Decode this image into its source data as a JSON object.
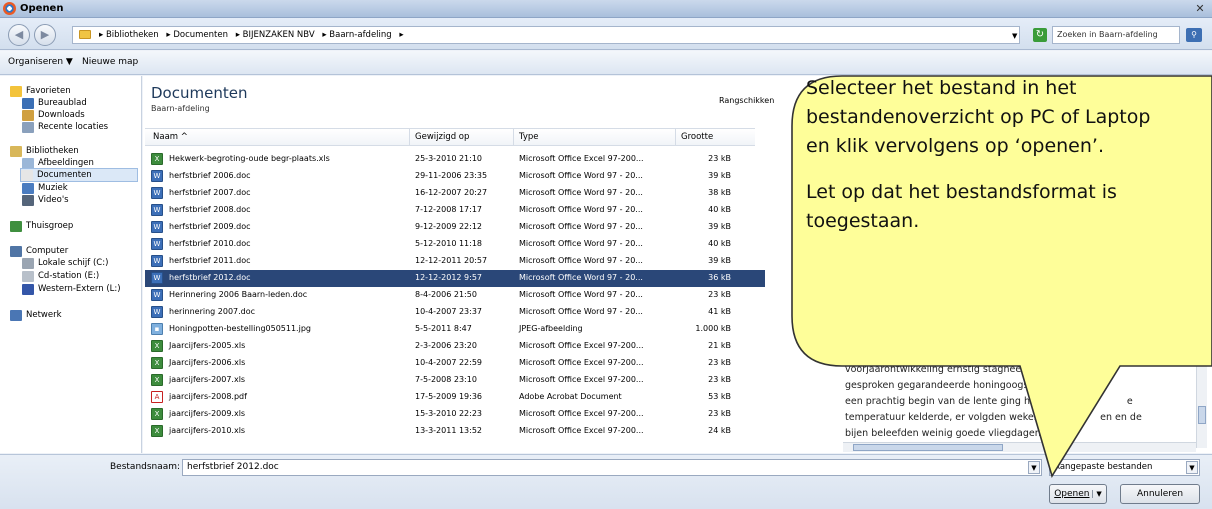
{
  "window": {
    "title": "Openen",
    "close_symbol": "✕"
  },
  "address": {
    "back": "◀",
    "forward": "▶",
    "breadcrumbs": [
      "▸ Bibliotheken",
      "▸ Documenten",
      "▸ BIJENZAKEN NBV",
      "▸ Baarn-afdeling",
      "▸"
    ],
    "dropdown": "▼",
    "search_placeholder": "Zoeken in Baarn-afdeling"
  },
  "toolbar": {
    "organize": "Organiseren ▼",
    "new_folder": "Nieuwe map"
  },
  "nav": {
    "items": [
      {
        "label": "Favorieten",
        "icon": "star-icon",
        "color": "#f3c33b"
      },
      {
        "label": "Bureaublad",
        "icon": "desktop-icon",
        "color": "#3b6fb5"
      },
      {
        "label": "Downloads",
        "icon": "downloads-icon",
        "color": "#d0a040"
      },
      {
        "label": "Recente locaties",
        "icon": "recent-icon",
        "color": "#8aa0bc"
      },
      {
        "label": "Bibliotheken",
        "icon": "library-icon",
        "color": "#d8b75a"
      },
      {
        "label": "Afbeeldingen",
        "icon": "pictures-icon",
        "color": "#9bb7d8"
      },
      {
        "label": "Documenten",
        "icon": "documents-icon",
        "color": "#e6e6e6"
      },
      {
        "label": "Muziek",
        "icon": "music-icon",
        "color": "#4a7cc0"
      },
      {
        "label": "Video's",
        "icon": "video-icon",
        "color": "#55657a"
      },
      {
        "label": "Thuisgroep",
        "icon": "homegroup-icon",
        "color": "#3f8f3f"
      },
      {
        "label": "Computer",
        "icon": "computer-icon",
        "color": "#5075a5"
      },
      {
        "label": "Lokale schijf (C:)",
        "icon": "drive-icon",
        "color": "#9aa5b2"
      },
      {
        "label": "Cd-station (E:)",
        "icon": "cd-icon",
        "color": "#b8c0ca"
      },
      {
        "label": "Western-Extern (L:)",
        "icon": "external-drive-icon",
        "color": "#3456a8"
      },
      {
        "label": "Netwerk",
        "icon": "network-icon",
        "color": "#4a76b4"
      }
    ]
  },
  "library": {
    "title": "Documenten",
    "subtitle": "Baarn-afdeling",
    "arrange_label": "Rangschikken"
  },
  "columns": {
    "name": "Naam",
    "sort_arrow": "^",
    "modified": "Gewijzigd op",
    "type": "Type",
    "size": "Grootte"
  },
  "files": [
    {
      "name": "Hekwerk-begroting-oude begr-plaats.xls",
      "date": "25-3-2010 21:10",
      "type": "Microsoft Office Excel 97-200...",
      "size": "23 kB",
      "kind": "xls"
    },
    {
      "name": "herfstbrief 2006.doc",
      "date": "29-11-2006 23:35",
      "type": "Microsoft Office Word 97 - 20...",
      "size": "39 kB",
      "kind": "doc"
    },
    {
      "name": "herfstbrief 2007.doc",
      "date": "16-12-2007 20:27",
      "type": "Microsoft Office Word 97 - 20...",
      "size": "38 kB",
      "kind": "doc"
    },
    {
      "name": "herfstbrief 2008.doc",
      "date": "7-12-2008 17:17",
      "type": "Microsoft Office Word 97 - 20...",
      "size": "40 kB",
      "kind": "doc"
    },
    {
      "name": "herfstbrief 2009.doc",
      "date": "9-12-2009 22:12",
      "type": "Microsoft Office Word 97 - 20...",
      "size": "39 kB",
      "kind": "doc"
    },
    {
      "name": "herfstbrief 2010.doc",
      "date": "5-12-2010 11:18",
      "type": "Microsoft Office Word 97 - 20...",
      "size": "40 kB",
      "kind": "doc"
    },
    {
      "name": "herfstbrief 2011.doc",
      "date": "12-12-2011 20:57",
      "type": "Microsoft Office Word 97 - 20...",
      "size": "39 kB",
      "kind": "doc"
    },
    {
      "name": "herfstbrief 2012.doc",
      "date": "12-12-2012 9:57",
      "type": "Microsoft Office Word 97 - 20...",
      "size": "36 kB",
      "kind": "doc",
      "selected": true
    },
    {
      "name": "Herinnering 2006 Baarn-leden.doc",
      "date": "8-4-2006 21:50",
      "type": "Microsoft Office Word 97 - 20...",
      "size": "23 kB",
      "kind": "doc"
    },
    {
      "name": "herinnering 2007.doc",
      "date": "10-4-2007 23:37",
      "type": "Microsoft Office Word 97 - 20...",
      "size": "41 kB",
      "kind": "doc"
    },
    {
      "name": "Honingpotten-bestelling050511.jpg",
      "date": "5-5-2011 8:47",
      "type": "JPEG-afbeelding",
      "size": "1.000 kB",
      "kind": "jpg"
    },
    {
      "name": "Jaarcijfers-2005.xls",
      "date": "2-3-2006 23:20",
      "type": "Microsoft Office Excel 97-200...",
      "size": "21 kB",
      "kind": "xls"
    },
    {
      "name": "Jaarcijfers-2006.xls",
      "date": "10-4-2007 22:59",
      "type": "Microsoft Office Excel 97-200...",
      "size": "23 kB",
      "kind": "xls"
    },
    {
      "name": "jaarcijfers-2007.xls",
      "date": "7-5-2008 23:10",
      "type": "Microsoft Office Excel 97-200...",
      "size": "23 kB",
      "kind": "xls"
    },
    {
      "name": "jaarcijfers-2008.pdf",
      "date": "17-5-2009 19:36",
      "type": "Adobe Acrobat Document",
      "size": "53 kB",
      "kind": "pdf"
    },
    {
      "name": "jaarcijfers-2009.xls",
      "date": "15-3-2010 22:23",
      "type": "Microsoft Office Excel 97-200...",
      "size": "23 kB",
      "kind": "xls"
    },
    {
      "name": "jaarcijfers-2010.xls",
      "date": "13-3-2011 13:52",
      "type": "Microsoft Office Excel 97-200...",
      "size": "24 kB",
      "kind": "xls"
    }
  ],
  "preview": {
    "lines": [
      "voorjaarontwikkeling ernstig stagneerde.",
      "gesproken gegarandeerde honingoogst w",
      "een prachtig begin van de lente ging het e",
      "temperatuur kelderde, er volgden weken",
      "bijen beleefden weinig goede vliegdagen."
    ],
    "fragment_right_1": "e",
    "fragment_right_2": "en en de"
  },
  "footer": {
    "filename_label": "Bestandsnaam:",
    "filename_value": "herfstbrief 2012.doc",
    "filter_value": "Aangepaste bestanden",
    "dropdown": "▼",
    "open_label": "Openen",
    "open_split": "▼",
    "cancel_label": "Annuleren"
  },
  "callout": {
    "lines": [
      "Selecteer het bestand in het",
      "bestandenoverzicht op PC of Laptop",
      "en klik vervolgens op ‘openen’."
    ],
    "lines2": [
      "Let op dat het bestandsformat is",
      "toegestaan."
    ],
    "fill": "#fefe99",
    "stroke": "#333333"
  }
}
